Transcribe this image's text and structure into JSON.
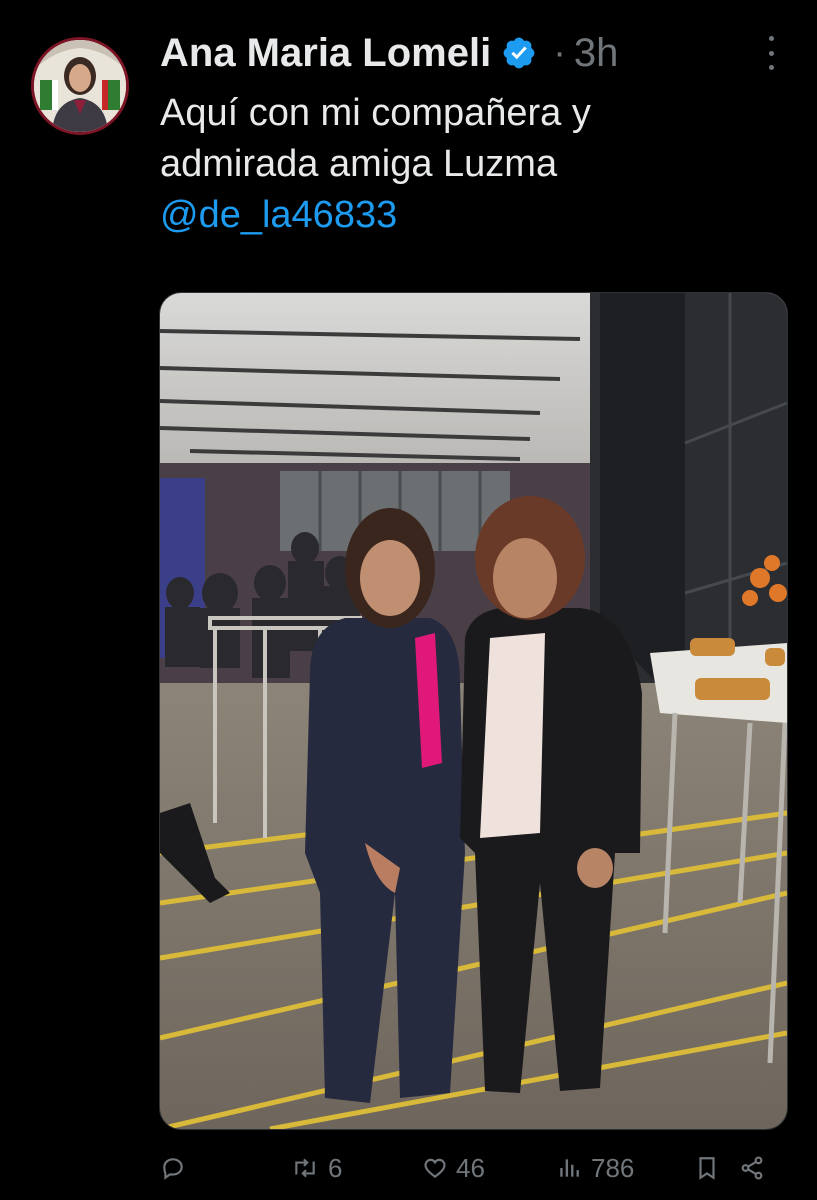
{
  "tweet": {
    "author_name": "Ana Maria Lomeli",
    "separator": "·",
    "time": "3h",
    "text_line1": "Aquí con mi compañera y",
    "text_line2": "admirada amiga Luzma",
    "mention": "@de_la46833"
  },
  "icons": {
    "verified": "verified-badge-icon",
    "more": "more-options-icon",
    "reply": "reply-icon",
    "repost": "repost-icon",
    "like": "heart-icon",
    "views": "views-icon",
    "bookmark": "bookmark-icon",
    "share": "share-icon"
  },
  "actions": {
    "reply_count": "",
    "repost_count": "6",
    "like_count": "46",
    "views_count": "786"
  },
  "colors": {
    "background": "#000000",
    "text": "#e7e9ea",
    "muted": "#71767b",
    "link": "#1d9bf0",
    "verified": "#1d9bf0"
  }
}
